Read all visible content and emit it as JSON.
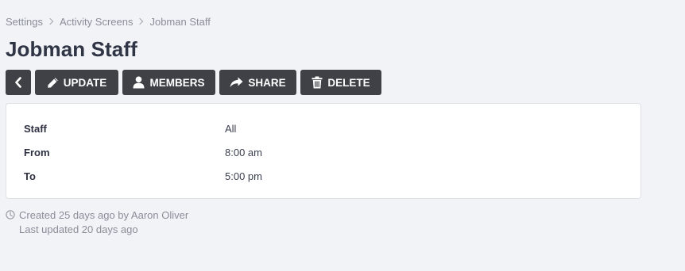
{
  "breadcrumb": {
    "items": [
      "Settings",
      "Activity Screens",
      "Jobman Staff"
    ]
  },
  "page": {
    "title": "Jobman Staff"
  },
  "toolbar": {
    "update_label": "UPDATE",
    "members_label": "MEMBERS",
    "share_label": "SHARE",
    "delete_label": "DELETE"
  },
  "details": {
    "rows": [
      {
        "label": "Staff",
        "value": "All"
      },
      {
        "label": "From",
        "value": "8:00 am"
      },
      {
        "label": "To",
        "value": "5:00 pm"
      }
    ]
  },
  "meta": {
    "created": "Created 25 days ago by Aaron Oliver",
    "updated": "Last updated 20 days ago"
  },
  "colors": {
    "background": "#f2f3f7",
    "button": "#3f4147",
    "title": "#2f3545",
    "muted": "#8a8e99"
  }
}
